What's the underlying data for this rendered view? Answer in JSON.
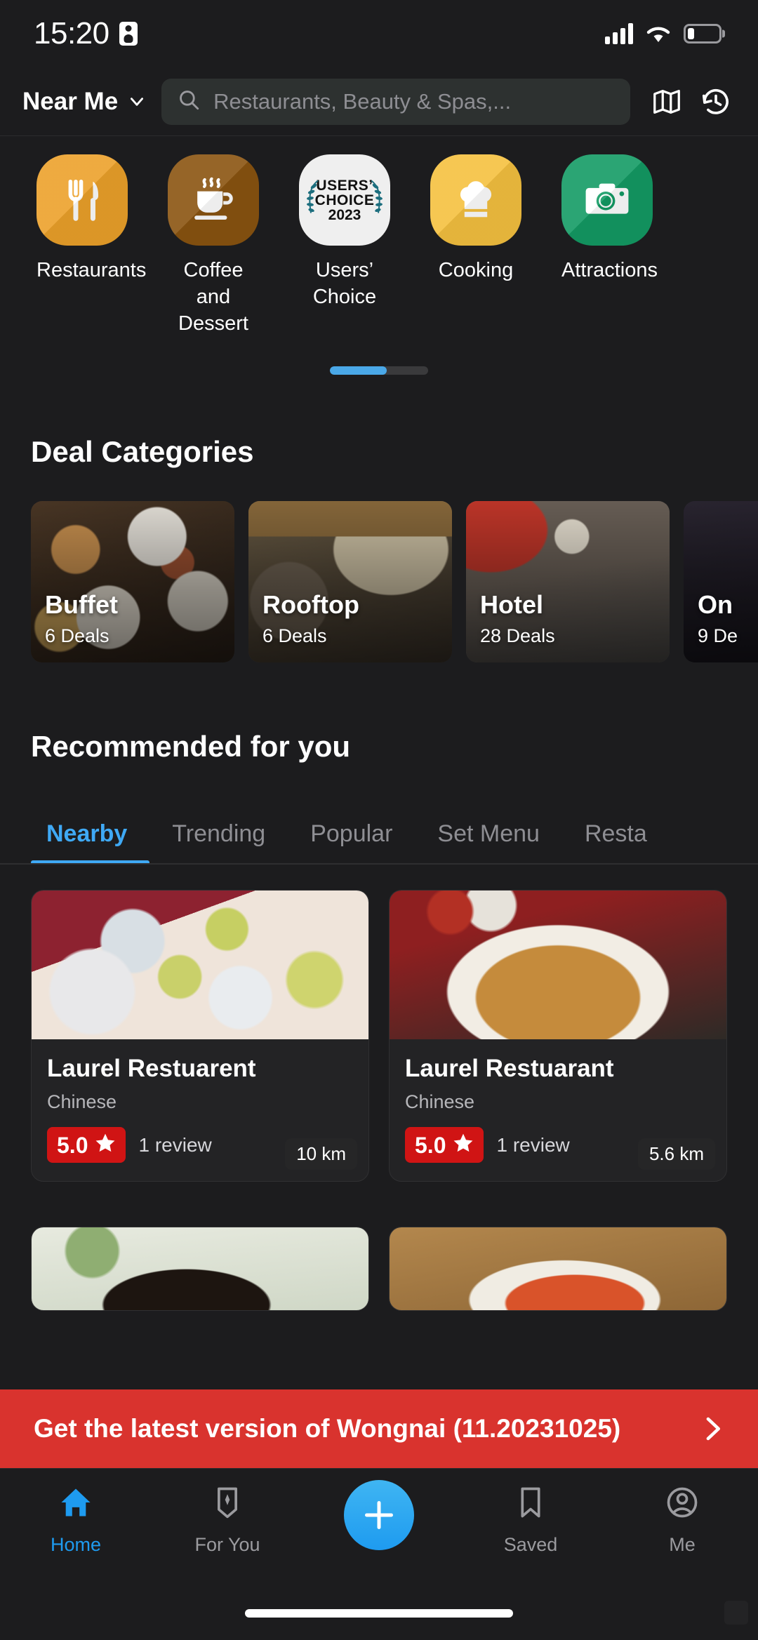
{
  "statusbar": {
    "time": "15:20",
    "mini_icon": "id-card-icon",
    "signal_icon": "cellular-signal-icon",
    "wifi_icon": "wifi-icon",
    "battery_icon": "battery-low-icon",
    "battery_level": "22%"
  },
  "header": {
    "location_label": "Near Me",
    "location_chevron": "chevron-down-icon",
    "search_placeholder": "Restaurants, Beauty & Spas,...",
    "search_value": "",
    "search_icon": "search-icon",
    "map_icon": "map-icon",
    "history_icon": "history-icon"
  },
  "categories": [
    {
      "label": "Restaurants",
      "icon": "fork-knife-icon",
      "color": "#eca12a"
    },
    {
      "label": "Coffee and Dessert",
      "icon": "coffee-cup-icon",
      "color": "#8a5410"
    },
    {
      "label": "Users’ Choice",
      "icon": "users-choice-badge-icon",
      "color": "#efefef",
      "badge": {
        "line1": "USERS’",
        "line2": "CHOICE",
        "line3": "2023"
      }
    },
    {
      "label": "Cooking",
      "icon": "chef-hat-icon",
      "color": "#f5c13f"
    },
    {
      "label": "Attractions",
      "icon": "camera-icon",
      "color": "#139b64"
    }
  ],
  "carousel": {
    "progress_percent": 58
  },
  "deal_section": {
    "title": "Deal Categories",
    "cards": [
      {
        "name": "Buffet",
        "deals": "6 Deals",
        "image": "buffet-food-photo"
      },
      {
        "name": "Rooftop",
        "deals": "6 Deals",
        "image": "rooftop-restaurant-photo"
      },
      {
        "name": "Hotel",
        "deals": "28 Deals",
        "image": "hotel-dining-photo"
      },
      {
        "name": "On",
        "deals": "9 De",
        "image": "dark-dish-photo"
      }
    ]
  },
  "recommend_section": {
    "title": "Recommended for you",
    "tabs": [
      {
        "label": "Nearby",
        "active": true
      },
      {
        "label": "Trending",
        "active": false
      },
      {
        "label": "Popular",
        "active": false
      },
      {
        "label": "Set Menu",
        "active": false
      },
      {
        "label": "Resta",
        "active": false
      }
    ],
    "cards": [
      {
        "name": "Laurel Restuarent",
        "cuisine": "Chinese",
        "rating": "5.0",
        "reviews": "1 review",
        "distance": "10 km",
        "image": "fruit-dessert-cups-photo",
        "star_icon": "star-icon"
      },
      {
        "name": "Laurel Restuarant",
        "cuisine": "Chinese",
        "rating": "5.0",
        "reviews": "1 review",
        "distance": "5.6 km",
        "image": "fried-noodles-plate-photo",
        "star_icon": "star-icon"
      }
    ],
    "partial_cards": [
      {
        "image": "soup-bowl-photo"
      },
      {
        "image": "braised-meat-photo"
      }
    ]
  },
  "update_banner": {
    "text": "Get the latest version of Wongnai (11.20231025)",
    "chevron": "chevron-right-icon",
    "color": "#d9332e"
  },
  "bottomnav": {
    "items": [
      {
        "label": "Home",
        "icon": "home-icon",
        "active": true
      },
      {
        "label": "For You",
        "icon": "bookmark-spark-icon",
        "active": false
      },
      {
        "label": "",
        "icon": "plus-icon",
        "active": false,
        "fab": true
      },
      {
        "label": "Saved",
        "icon": "bookmark-icon",
        "active": false
      },
      {
        "label": "Me",
        "icon": "account-icon",
        "active": false
      }
    ],
    "accent_color": "#1e9bf0"
  }
}
